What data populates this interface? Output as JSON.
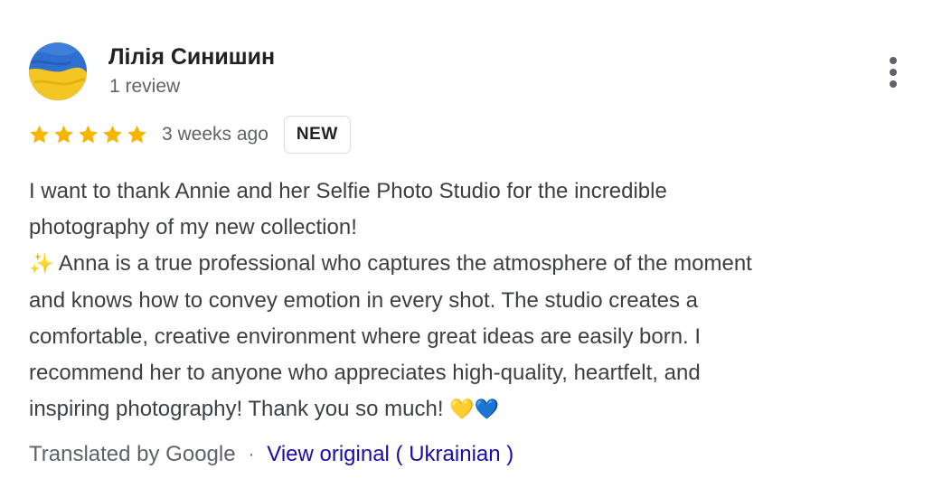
{
  "reviewer": {
    "name": "Лілія Синишин",
    "review_count": "1 review",
    "avatar_icon": "ukrainian-flag-avatar"
  },
  "rating": {
    "stars": 5,
    "star_color": "#f7b500",
    "date": "3 weeks ago",
    "badge": "NEW"
  },
  "menu": {
    "icon": "more-vert-icon"
  },
  "review": {
    "lines": [
      "I want to thank Annie and her Selfie Photo Studio for the incredible",
      "photography of my new collection!",
      "Anna is a true professional who captures the atmosphere of the moment",
      "and knows how to convey emotion in every shot. The studio creates a",
      "comfortable, creative environment where great ideas are easily born. I",
      "recommend her to anyone who appreciates high-quality, heartfelt, and",
      "inspiring photography! Thank you so much!"
    ],
    "sparkle_emoji": "✨",
    "heart_yellow_emoji": "💛",
    "heart_blue_emoji": "💙"
  },
  "footer": {
    "translated_label": "Translated by Google",
    "separator": "·",
    "view_original_label": "View original ( Ukrainian )",
    "link_color": "#1a0dab"
  }
}
